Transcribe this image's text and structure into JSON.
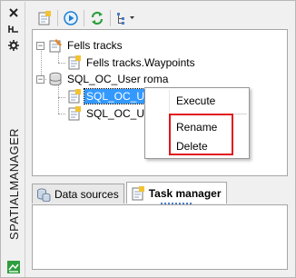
{
  "sidebar": {
    "title": "SPATIALMANAGER",
    "buttons": [
      "close-icon",
      "pin-icon",
      "settings-icon"
    ]
  },
  "toolbar": {
    "buttons": [
      "new-task-icon",
      "run-icon",
      "refresh-icon",
      "tree-view-icon"
    ]
  },
  "tree": {
    "items": [
      {
        "label": "Fells tracks"
      },
      {
        "label": "Fells tracks.Waypoints"
      },
      {
        "label": "SQL_OC_User roma"
      },
      {
        "label": "SQL_OC_User roma.BATIMENT"
      },
      {
        "label": "SQL_OC_Use"
      }
    ]
  },
  "context_menu": {
    "items": [
      {
        "label": "Execute"
      },
      {
        "label": "Rename"
      },
      {
        "label": "Delete"
      }
    ],
    "highlight_color": "#e0161d"
  },
  "tabs": [
    {
      "label": "Data sources",
      "active": false
    },
    {
      "label": "Task manager",
      "active": true
    }
  ],
  "colors": {
    "selection": "#3399ff",
    "accent": "#1a7fd4"
  }
}
